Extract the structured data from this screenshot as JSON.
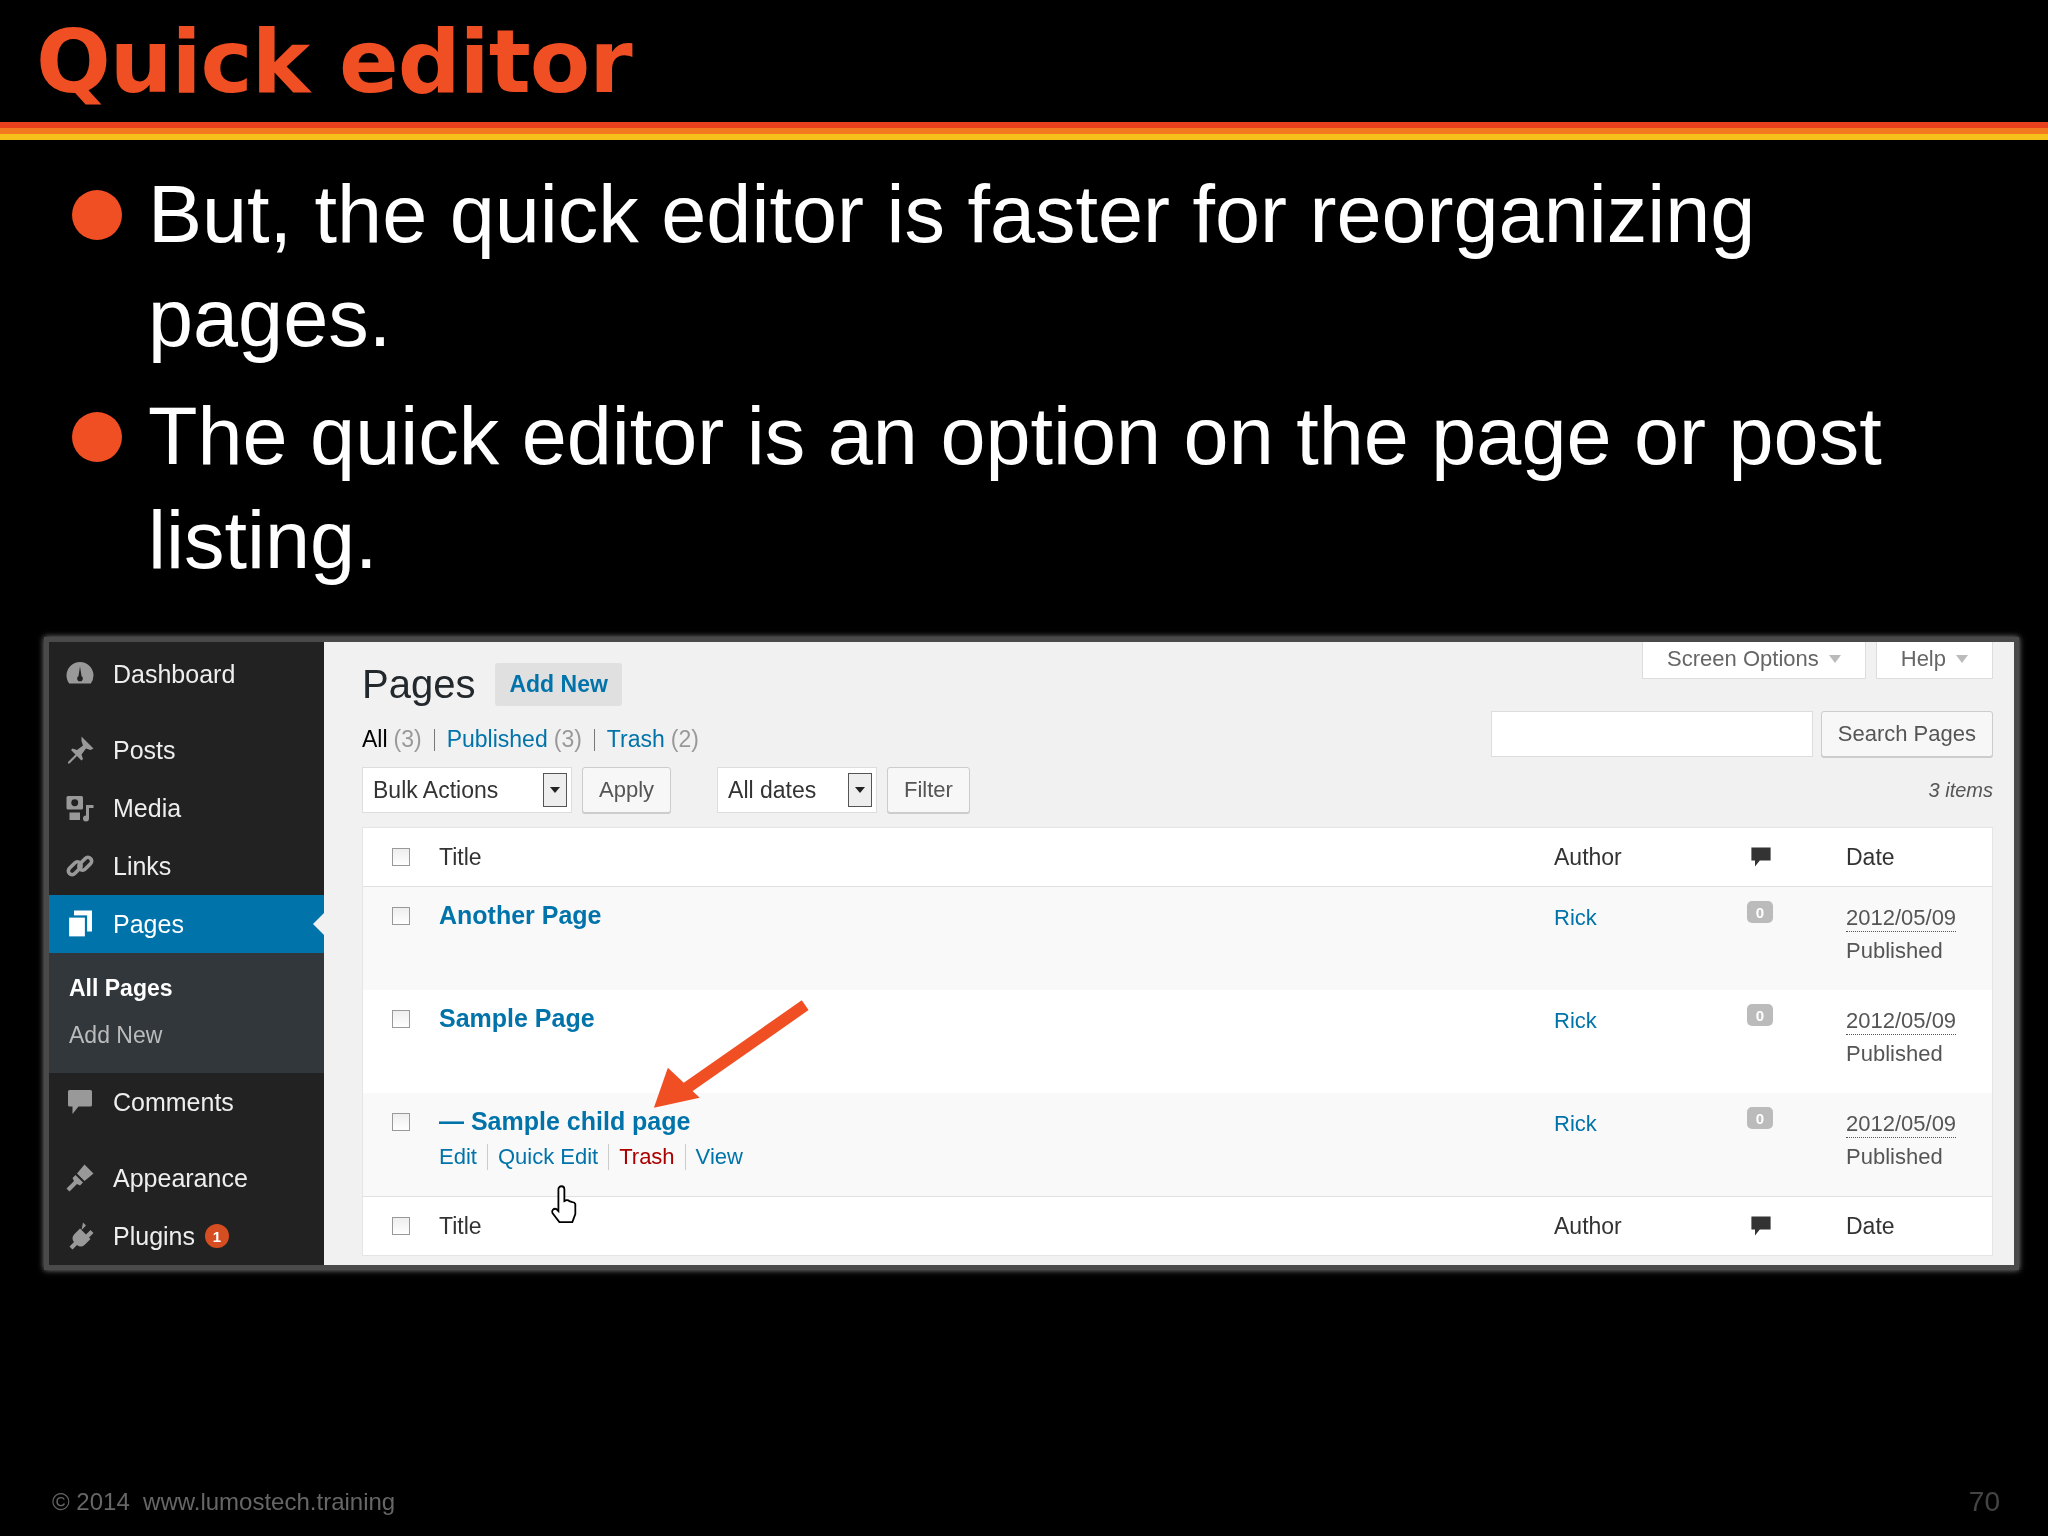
{
  "slide": {
    "title": "Quick editor",
    "bullets": [
      "But, the quick editor is faster for reorganizing pages.",
      "The quick editor is an option on the page or post listing."
    ],
    "footer": "© 2014  www.lumostech.training",
    "page_number": "70"
  },
  "screenshot": {
    "sidebar": {
      "items": [
        {
          "label": "Dashboard",
          "selected": false
        },
        {
          "label": "Posts",
          "selected": false
        },
        {
          "label": "Media",
          "selected": false
        },
        {
          "label": "Links",
          "selected": false
        },
        {
          "label": "Pages",
          "selected": true,
          "children": [
            {
              "label": "All Pages",
              "selected": true
            },
            {
              "label": "Add New",
              "selected": false
            }
          ]
        },
        {
          "label": "Comments",
          "selected": false
        },
        {
          "label": "Appearance",
          "selected": false
        },
        {
          "label": "Plugins",
          "selected": false,
          "badge": "1"
        }
      ]
    },
    "header_tabs": [
      "Screen Options",
      "Help"
    ],
    "heading": "Pages",
    "add_new": "Add New",
    "filters": [
      {
        "label": "All",
        "count": "(3)",
        "selected": true
      },
      {
        "label": "Published",
        "count": "(3)",
        "selected": false
      },
      {
        "label": "Trash",
        "count": "(2)",
        "selected": false
      }
    ],
    "bulk_actions": "Bulk Actions",
    "apply": "Apply",
    "dates": "All dates",
    "filter": "Filter",
    "search_button": "Search Pages",
    "items_count": "3 items",
    "table": {
      "columns": [
        "Title",
        "Author",
        "Date"
      ],
      "select_all_checked": false,
      "rows": [
        {
          "title": "Another Page",
          "author": "Rick",
          "comments": "0",
          "date": "2012/05/09",
          "status": "Published",
          "checked": false
        },
        {
          "title": "Sample Page",
          "author": "Rick",
          "comments": "0",
          "date": "2012/05/09",
          "status": "Published",
          "checked": false
        },
        {
          "title": "— Sample child page",
          "author": "Rick",
          "comments": "0",
          "date": "2012/05/09",
          "status": "Published",
          "checked": false,
          "actions": [
            {
              "label": "Edit",
              "kind": "link"
            },
            {
              "label": "Quick Edit",
              "kind": "link"
            },
            {
              "label": "Trash",
              "kind": "delete"
            },
            {
              "label": "View",
              "kind": "link"
            }
          ]
        }
      ],
      "footer_columns": [
        "Title",
        "Author",
        "Date"
      ],
      "footer_select_all_checked": false
    }
  }
}
